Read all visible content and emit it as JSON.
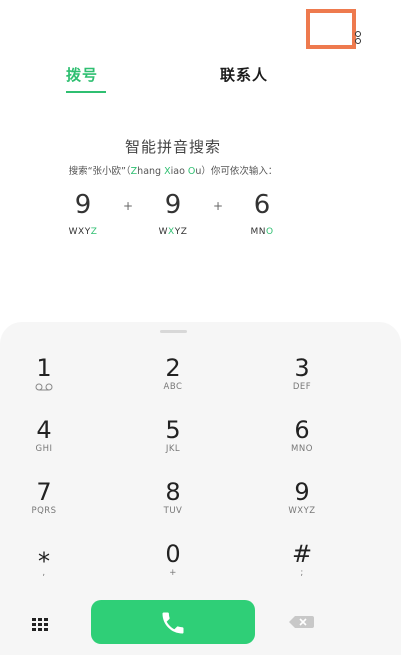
{
  "header": {
    "overflow_icon": "more-vertical-icon",
    "highlight_color": "#ee7a4e"
  },
  "tabs": {
    "dial_label": "拨号",
    "contacts_label": "联系人",
    "active_color": "#2fbf71"
  },
  "smart_search": {
    "title": "智能拼音搜索",
    "desc_prefix": "搜索“张小欧”（",
    "z_hl": "Z",
    "hang": "hang ",
    "x_hl": "X",
    "iao": "iao ",
    "o_hl": "O",
    "u": "u",
    "desc_suffix": "）你可依次输入：",
    "example": [
      {
        "digit": "9",
        "letters_pre": "WXY",
        "letters_hl": "Z",
        "letters_post": ""
      },
      {
        "digit": "9",
        "letters_pre": "W",
        "letters_hl": "X",
        "letters_post": "YZ"
      },
      {
        "digit": "6",
        "letters_pre": "MN",
        "letters_hl": "O",
        "letters_post": ""
      }
    ],
    "plus": "+"
  },
  "keypad": {
    "keys": [
      {
        "num": "1",
        "sub": "voicemail-icon"
      },
      {
        "num": "2",
        "sub": "ABC"
      },
      {
        "num": "3",
        "sub": "DEF"
      },
      {
        "num": "4",
        "sub": "GHI"
      },
      {
        "num": "5",
        "sub": "JKL"
      },
      {
        "num": "6",
        "sub": "MNO"
      },
      {
        "num": "7",
        "sub": "PQRS"
      },
      {
        "num": "8",
        "sub": "TUV"
      },
      {
        "num": "9",
        "sub": "WXYZ"
      },
      {
        "num": "⁎",
        "sub": ","
      },
      {
        "num": "0",
        "sub": "+"
      },
      {
        "num": "#",
        "sub": ";"
      }
    ],
    "grid_icon": "dialpad-grid-icon",
    "call_icon": "phone-icon",
    "call_color": "#2fcf77",
    "delete_icon": "backspace-icon"
  }
}
